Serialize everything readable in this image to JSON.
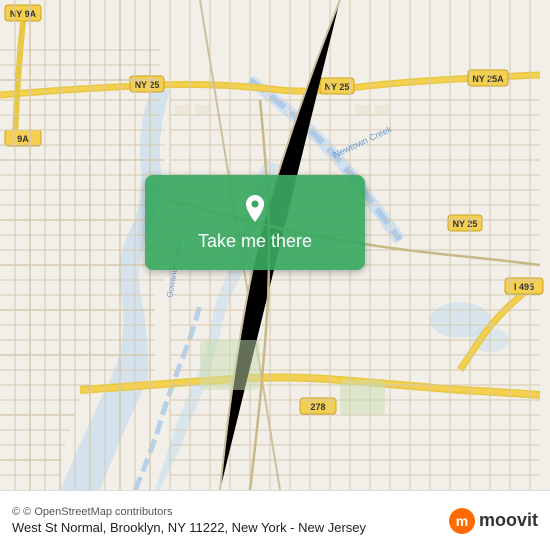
{
  "map": {
    "background_color": "#f2efe9",
    "center_lat": 40.678,
    "center_lng": -73.99
  },
  "button": {
    "label": "Take me there",
    "bg_color": "#3aa85f"
  },
  "attribution": {
    "text": "© OpenStreetMap contributors"
  },
  "address": {
    "full": "West St Normal, Brooklyn, NY 11222, New York - New Jersey"
  },
  "logo": {
    "name": "moovit",
    "letter": "m"
  },
  "icons": {
    "pin": "📍",
    "map_marker": "location-pin-icon"
  }
}
